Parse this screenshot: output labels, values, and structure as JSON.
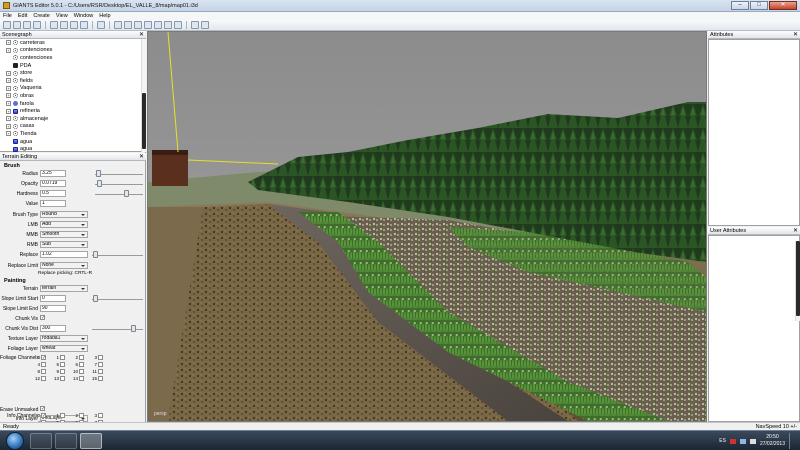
{
  "window": {
    "title": "GIANTS Editor 5.0.1 - C:/Users/RSR/Desktop/EL_VALLE_8/map/map01.i3d",
    "min_label": "–",
    "max_label": "□",
    "close_label": "✕"
  },
  "menu": [
    "File",
    "Edit",
    "Create",
    "View",
    "Window",
    "Help"
  ],
  "scenegraph": {
    "title": "Scenegraph",
    "close_label": "✕",
    "items": [
      {
        "label": "carreteras",
        "icon": "transform-group-icon",
        "expandable": true
      },
      {
        "label": "contenciones",
        "icon": "transform-group-icon",
        "expandable": true
      },
      {
        "label": "contenciones",
        "icon": "transform-group-icon",
        "expandable": false
      },
      {
        "label": "PDA",
        "icon": "shape-icon",
        "expandable": false
      },
      {
        "label": "store",
        "icon": "transform-group-icon",
        "expandable": true
      },
      {
        "label": "fields",
        "icon": "transform-group-icon",
        "expandable": true
      },
      {
        "label": "Vaqueria",
        "icon": "transform-group-icon",
        "expandable": true
      },
      {
        "label": "obras",
        "icon": "transform-group-icon",
        "expandable": true
      },
      {
        "label": "farola",
        "icon": "light-icon",
        "expandable": true
      },
      {
        "label": "refineria",
        "icon": "blue-shape-icon",
        "expandable": true
      },
      {
        "label": "almacenaje",
        "icon": "transform-group-icon",
        "expandable": true
      },
      {
        "label": "casas",
        "icon": "transform-group-icon",
        "expandable": true
      },
      {
        "label": "Tienda",
        "icon": "transform-group-icon",
        "expandable": true
      },
      {
        "label": "agua",
        "icon": "blue-shape-icon",
        "expandable": false
      },
      {
        "label": "agua",
        "icon": "blue-shape-icon",
        "expandable": false
      }
    ]
  },
  "terrain": {
    "title": "Terrain Editing",
    "close_label": "✕",
    "brush_label": "Brush",
    "radius": {
      "label": "Radius",
      "value": "3.25"
    },
    "opacity": {
      "label": "Opacity",
      "value": "0.0719"
    },
    "hardness": {
      "label": "Hardness",
      "value": "0.5"
    },
    "value": {
      "label": "Value",
      "value": "1"
    },
    "brush_type": {
      "label": "Brush Type",
      "value": "Round"
    },
    "lmb": {
      "label": "LMB",
      "value": "Add"
    },
    "mmb": {
      "label": "MMB",
      "value": "Smooth"
    },
    "rmb": {
      "label": "RMB",
      "value": "Sub"
    },
    "replace": {
      "label": "Replace",
      "value": "1.02"
    },
    "replace_limit": {
      "label": "Replace Limit",
      "value": "None"
    },
    "replace_note": "Replace picking: CRTL-R",
    "painting_label": "Painting",
    "paint_terrain": {
      "label": "Terrain",
      "value": "terrain"
    },
    "slope_start": {
      "label": "Slope Limit Start",
      "value": "0"
    },
    "slope_end": {
      "label": "Slope Limit End",
      "value": "90"
    },
    "chunk_vis": {
      "label": "Chunk Vis",
      "mark": "✓"
    },
    "chunk_vis_dist": {
      "label": "Chunk Vis Dist",
      "value": "300"
    },
    "texture_layer": {
      "label": "Texture Layer",
      "value": "rodada1"
    },
    "foliage_layer": {
      "label": "Foliage Layer",
      "value": "wheat"
    },
    "foliage_channels": {
      "label": "Foliage Channels",
      "checked_index": 0,
      "mark": "✓",
      "numbers": [
        "0",
        "1",
        "2",
        "3",
        "4",
        "5",
        "6",
        "7",
        "8",
        "9",
        "10",
        "11",
        "12",
        "13",
        "14",
        "15"
      ]
    },
    "erase_unmasked": {
      "label": "Erase Unmasked",
      "mark": "✓"
    },
    "info_layer": {
      "label": "Info Layer",
      "value": "infoLayer"
    },
    "info_channels": {
      "label": "Info Channels",
      "checked_index": 0,
      "mark": "✓",
      "numbers": [
        "0",
        "1",
        "2",
        "3",
        "4",
        "5",
        "6",
        "7",
        "8",
        "9",
        "10",
        "11",
        "12",
        "13",
        "14",
        "15"
      ]
    }
  },
  "viewport": {
    "camera_label": "persp"
  },
  "attributes": {
    "title": "Attributes",
    "close_label": "✕"
  },
  "user_attributes": {
    "title": "User Attributes",
    "close_label": "✕"
  },
  "status": {
    "left": "Ready",
    "right": "NavSpeed 10 +/-"
  },
  "taskbar": {
    "language": "ES",
    "time": "20:50",
    "date": "27/02/2013"
  }
}
